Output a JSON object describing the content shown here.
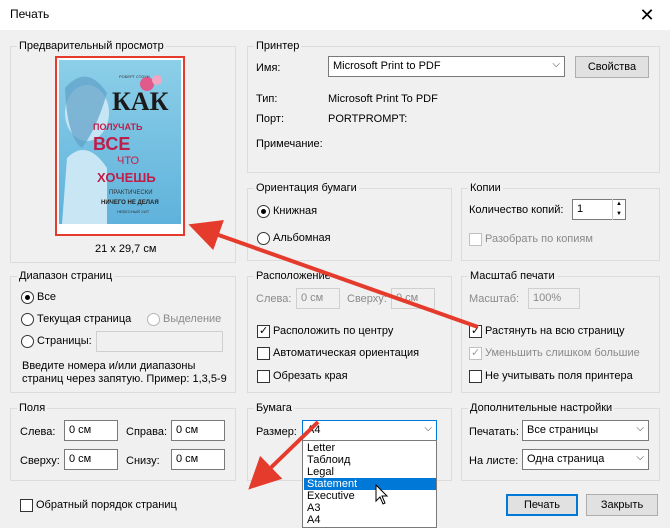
{
  "window": {
    "title": "Печать",
    "close_glyph": "✕"
  },
  "preview": {
    "group_label": "Предварительный просмотр",
    "page_size": "21 x 29,7 см",
    "cover": {
      "author": "РОБЕРТ СТОУН",
      "word1": "КАК",
      "line2": "ПОЛУЧАТЬ",
      "line3": "ВСЕ",
      "line4": "ЧТО",
      "line5": "ХОЧЕШЬ",
      "line6": "ПРАКТИЧЕСКИ",
      "line7": "НИЧЕГО НЕ ДЕЛАЯ",
      "line8": "НЕБЕСНЫЙ ХИТ"
    }
  },
  "printer": {
    "group_label": "Принтер",
    "name_label": "Имя:",
    "name_value": "Microsoft Print to PDF",
    "properties_button": "Свойства",
    "type_label": "Тип:",
    "type_value": "Microsoft Print To PDF",
    "port_label": "Порт:",
    "port_value": "PORTPROMPT:",
    "comment_label": "Примечание:"
  },
  "orientation": {
    "group_label": "Ориентация бумаги",
    "portrait": "Книжная",
    "landscape": "Альбомная",
    "selected": "portrait"
  },
  "copies": {
    "group_label": "Копии",
    "count_label": "Количество копий:",
    "count_value": "1",
    "collate_label": "Разобрать по копиям"
  },
  "page_range": {
    "group_label": "Диапазон страниц",
    "all": "Все",
    "current": "Текущая страница",
    "selection": "Выделение",
    "pages": "Страницы:",
    "hint_line1": "Введите номера и/или диапазоны",
    "hint_line2": "страниц через запятую. Пример: 1,3,5-9"
  },
  "layout": {
    "group_label": "Расположение",
    "left_label": "Слева:",
    "left_value": "0 см",
    "top_label": "Сверху:",
    "top_value": "0 см",
    "center_label": "Расположить по центру",
    "auto_orient_label": "Автоматическая ориентация",
    "crop_label": "Обрезать края"
  },
  "scale": {
    "group_label": "Масштаб печати",
    "scale_label": "Масштаб:",
    "scale_value": "100%",
    "stretch_label": "Растянуть на всю страницу",
    "shrink_label": "Уменьшить слишком большие",
    "ignore_margins_label": "Не учитывать поля принтера"
  },
  "margins": {
    "group_label": "Поля",
    "left_label": "Слева:",
    "left_value": "0 см",
    "right_label": "Справа:",
    "right_value": "0 см",
    "top_label": "Сверху:",
    "top_value": "0 см",
    "bottom_label": "Снизу:",
    "bottom_value": "0 см"
  },
  "paper": {
    "group_label": "Бумага",
    "size_label": "Размер:",
    "size_value": "A4",
    "options": [
      "Letter",
      "Таблоид",
      "Legal",
      "Statement",
      "Executive",
      "A3",
      "A4"
    ],
    "highlighted": "Statement"
  },
  "advanced": {
    "group_label": "Дополнительные настройки",
    "print_label": "Печатать:",
    "print_value": "Все страницы",
    "per_sheet_label": "На листе:",
    "per_sheet_value": "Одна страница"
  },
  "footer": {
    "reverse_order_label": "Обратный порядок страниц",
    "print_button": "Печать",
    "close_button": "Закрыть"
  },
  "colors": {
    "annotation_arrow": "#e53b2c",
    "selection": "#0078d7"
  }
}
